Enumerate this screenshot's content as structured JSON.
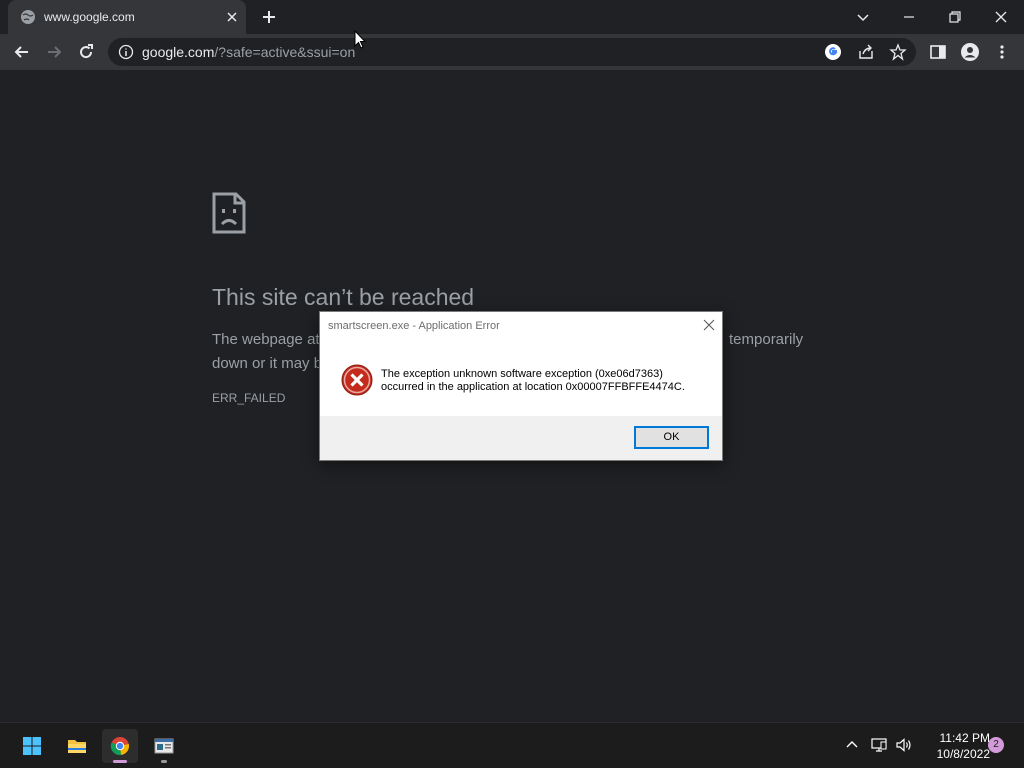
{
  "browser": {
    "tab": {
      "title": "www.google.com"
    },
    "omnibox": {
      "host": "google.com",
      "path": "/?safe=active&ssui=on"
    }
  },
  "page": {
    "title": "This site can’t be reached",
    "desc_left": "The webpage at",
    "desc_right": "temporarily",
    "desc_line2": "down or it may b",
    "error_code": "ERR_FAILED"
  },
  "dialog": {
    "title": "smartscreen.exe - Application Error",
    "message_line1": "The exception unknown software exception (0xe06d7363)",
    "message_line2": "occurred in the application at location 0x00007FFBFFE4474C.",
    "ok_label": "OK"
  },
  "taskbar": {
    "apps": [
      {
        "icon": "start-icon"
      },
      {
        "icon": "file-explorer-icon"
      },
      {
        "icon": "chrome-icon",
        "active": true
      },
      {
        "icon": "terminal-icon"
      }
    ],
    "clock_time": "11:42 PM",
    "clock_date": "10/8/2022",
    "notification_count": "2"
  },
  "colors": {
    "page_bg": "#202124",
    "toolbar_bg": "#35363a",
    "error_text": "#9aa0a6",
    "dialog_error_red": "#c42b1c",
    "accent": "#0078d7"
  }
}
